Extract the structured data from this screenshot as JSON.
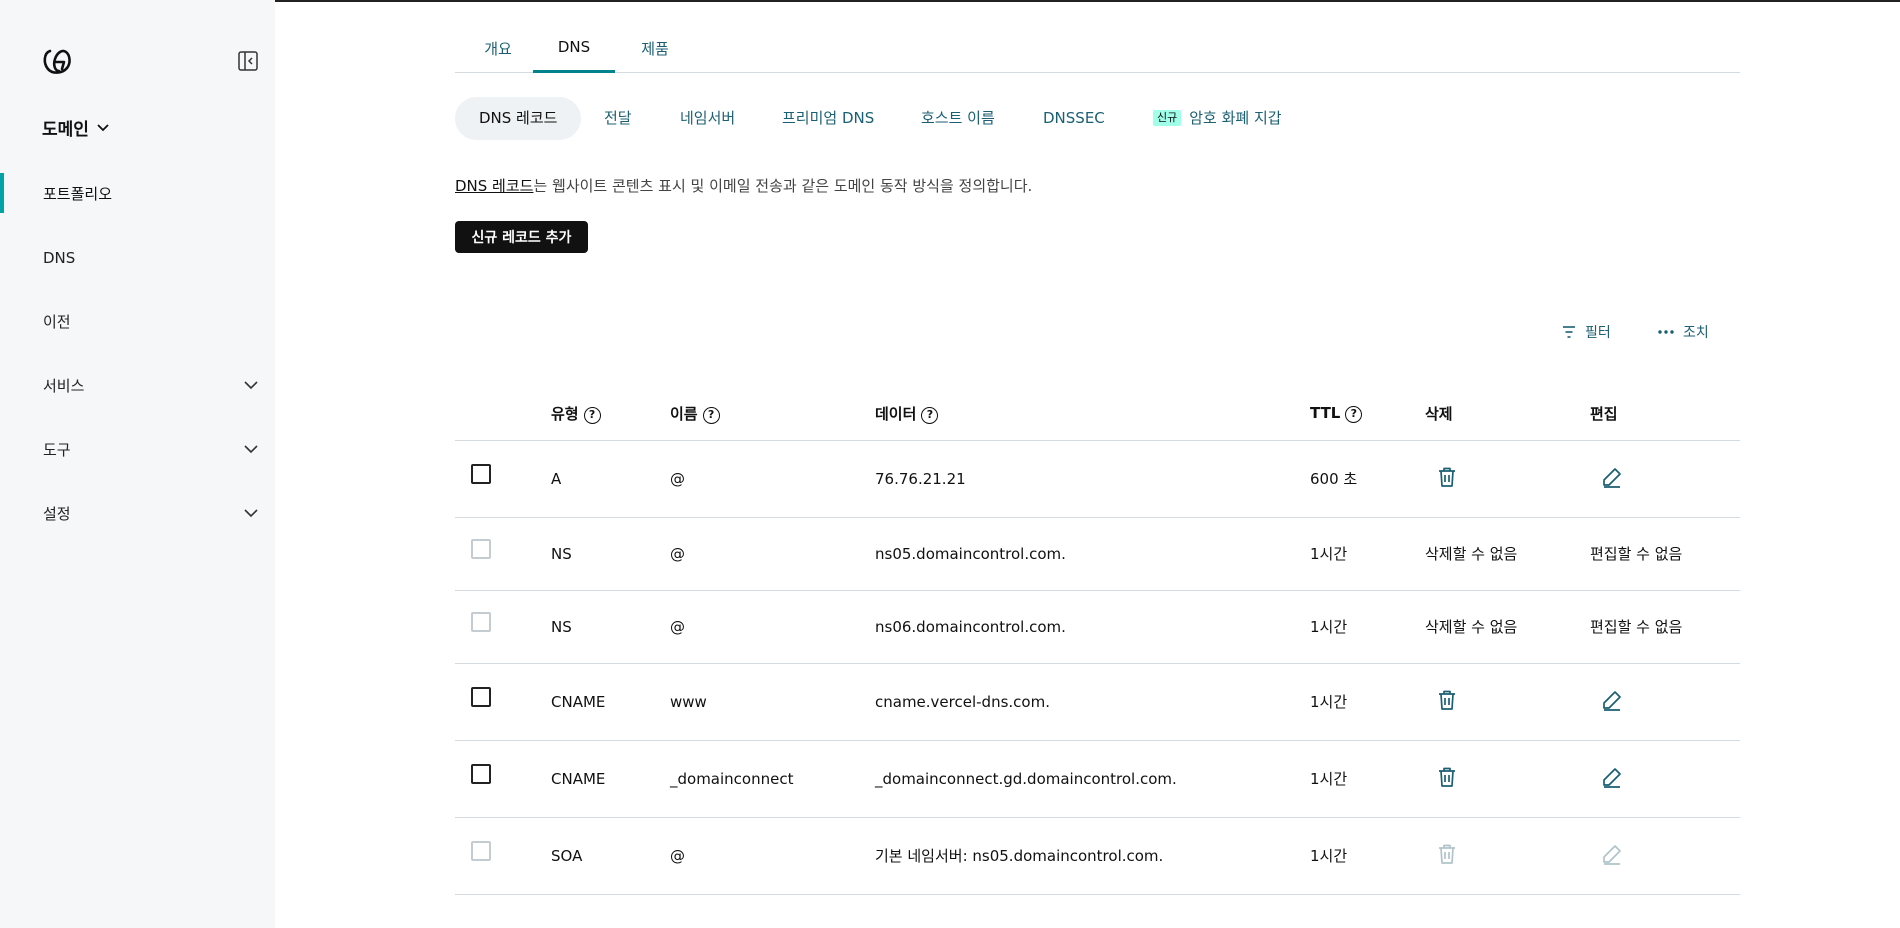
{
  "sidebar": {
    "domain_menu_label": "도메인",
    "items": [
      {
        "label": "포트폴리오"
      },
      {
        "label": "DNS"
      },
      {
        "label": "이전"
      },
      {
        "label": "서비스"
      },
      {
        "label": "도구"
      },
      {
        "label": "설정"
      }
    ]
  },
  "main_tabs": [
    {
      "label": "개요"
    },
    {
      "label": "DNS"
    },
    {
      "label": "제품"
    }
  ],
  "sub_tabs": [
    {
      "label": "DNS 레코드"
    },
    {
      "label": "전달"
    },
    {
      "label": "네임서버"
    },
    {
      "label": "프리미엄 DNS"
    },
    {
      "label": "호스트 이름"
    },
    {
      "label": "DNSSEC"
    },
    {
      "label": "암호 화폐 지갑",
      "badge": "신규"
    }
  ],
  "description": {
    "link": "DNS 레코드",
    "text": "는 웹사이트 콘텐츠 표시 및 이메일 전송과 같은 도메인 동작 방식을 정의합니다."
  },
  "add_record_label": "신규 레코드 추가",
  "toolbar": {
    "filter_label": "필터",
    "actions_label": "조치"
  },
  "table": {
    "headers": {
      "type": "유형",
      "name": "이름",
      "data": "데이터",
      "ttl": "TTL",
      "delete": "삭제",
      "edit": "편집"
    },
    "help_glyph": "?",
    "rows": [
      {
        "type": "A",
        "name": "@",
        "data": "76.76.21.21",
        "ttl": "600 초"
      },
      {
        "type": "NS",
        "name": "@",
        "data": "ns05.domaincontrol.com.",
        "ttl": "1시간",
        "delete_text": "삭제할 수 없음",
        "edit_text": "편집할 수 없음"
      },
      {
        "type": "NS",
        "name": "@",
        "data": "ns06.domaincontrol.com.",
        "ttl": "1시간",
        "delete_text": "삭제할 수 없음",
        "edit_text": "편집할 수 없음"
      },
      {
        "type": "CNAME",
        "name": "www",
        "data": "cname.vercel-dns.com.",
        "ttl": "1시간"
      },
      {
        "type": "CNAME",
        "name": "_domainconnect",
        "data": "_domainconnect.gd.domaincontrol.com.",
        "ttl": "1시간"
      },
      {
        "type": "SOA",
        "name": "@",
        "data": "기본 네임서버: ns05.domaincontrol.com.",
        "ttl": "1시간"
      }
    ]
  },
  "colors": {
    "accent": "#00a4a6",
    "link": "#1a5f73",
    "icon": "#1a5f73",
    "icon_disabled": "#b0c4cb",
    "sidebar_bg": "#f5f7f8",
    "new_badge_bg": "#9fffe8"
  }
}
